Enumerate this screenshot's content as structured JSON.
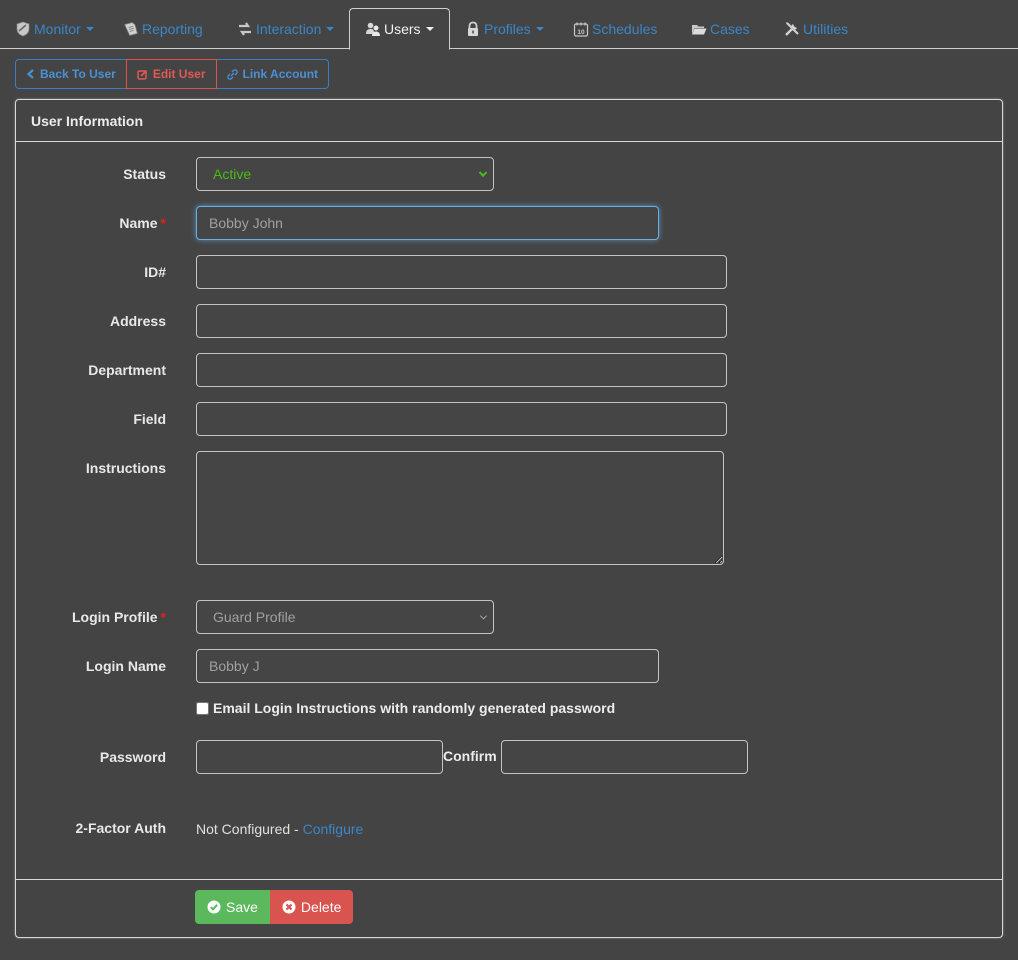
{
  "nav": {
    "items": [
      {
        "label": "Monitor",
        "icon": "shield-icon",
        "dropdown": true,
        "active": false
      },
      {
        "label": "Reporting",
        "icon": "report-document-icon",
        "dropdown": false,
        "active": false
      },
      {
        "label": "Interaction",
        "icon": "exchange-arrows-icon",
        "dropdown": true,
        "active": false
      },
      {
        "label": "Users",
        "icon": "users-icon",
        "dropdown": true,
        "active": true
      },
      {
        "label": "Profiles",
        "icon": "lock-icon",
        "dropdown": true,
        "active": false
      },
      {
        "label": "Schedules",
        "icon": "calendar-icon",
        "dropdown": false,
        "active": false
      },
      {
        "label": "Cases",
        "icon": "folder-open-icon",
        "dropdown": false,
        "active": false
      },
      {
        "label": "Utilities",
        "icon": "tools-icon",
        "dropdown": false,
        "active": false
      }
    ],
    "calendar_day": "10"
  },
  "toolbar": {
    "back_label": "Back To User",
    "edit_label": "Edit User",
    "link_label": "Link Account"
  },
  "panel": {
    "title": "User Information"
  },
  "form": {
    "status": {
      "label": "Status",
      "value": "Active"
    },
    "name": {
      "label": "Name",
      "value": "Bobby John",
      "required_mark": "*"
    },
    "id": {
      "label": "ID#",
      "value": ""
    },
    "address": {
      "label": "Address",
      "value": ""
    },
    "department": {
      "label": "Department",
      "value": ""
    },
    "field": {
      "label": "Field",
      "value": ""
    },
    "instructions": {
      "label": "Instructions",
      "value": ""
    },
    "login_profile": {
      "label": "Login Profile",
      "value": "Guard Profile",
      "required_mark": "*"
    },
    "login_name": {
      "label": "Login Name",
      "value": "Bobby J"
    },
    "email_instructions": {
      "label": "Email Login Instructions with randomly generated password",
      "checked": false
    },
    "password": {
      "label": "Password",
      "value": ""
    },
    "confirm": {
      "label": "Confirm",
      "value": ""
    },
    "two_factor": {
      "label": "2-Factor Auth",
      "status": "Not Configured - ",
      "configure_link": "Configure"
    }
  },
  "footer": {
    "save_label": "Save",
    "delete_label": "Delete"
  },
  "colors": {
    "background": "#444444",
    "link": "#3a86c8",
    "status_active": "#4cbb17",
    "save": "#5cb85c",
    "delete": "#d9534f",
    "required": "#e02020"
  }
}
